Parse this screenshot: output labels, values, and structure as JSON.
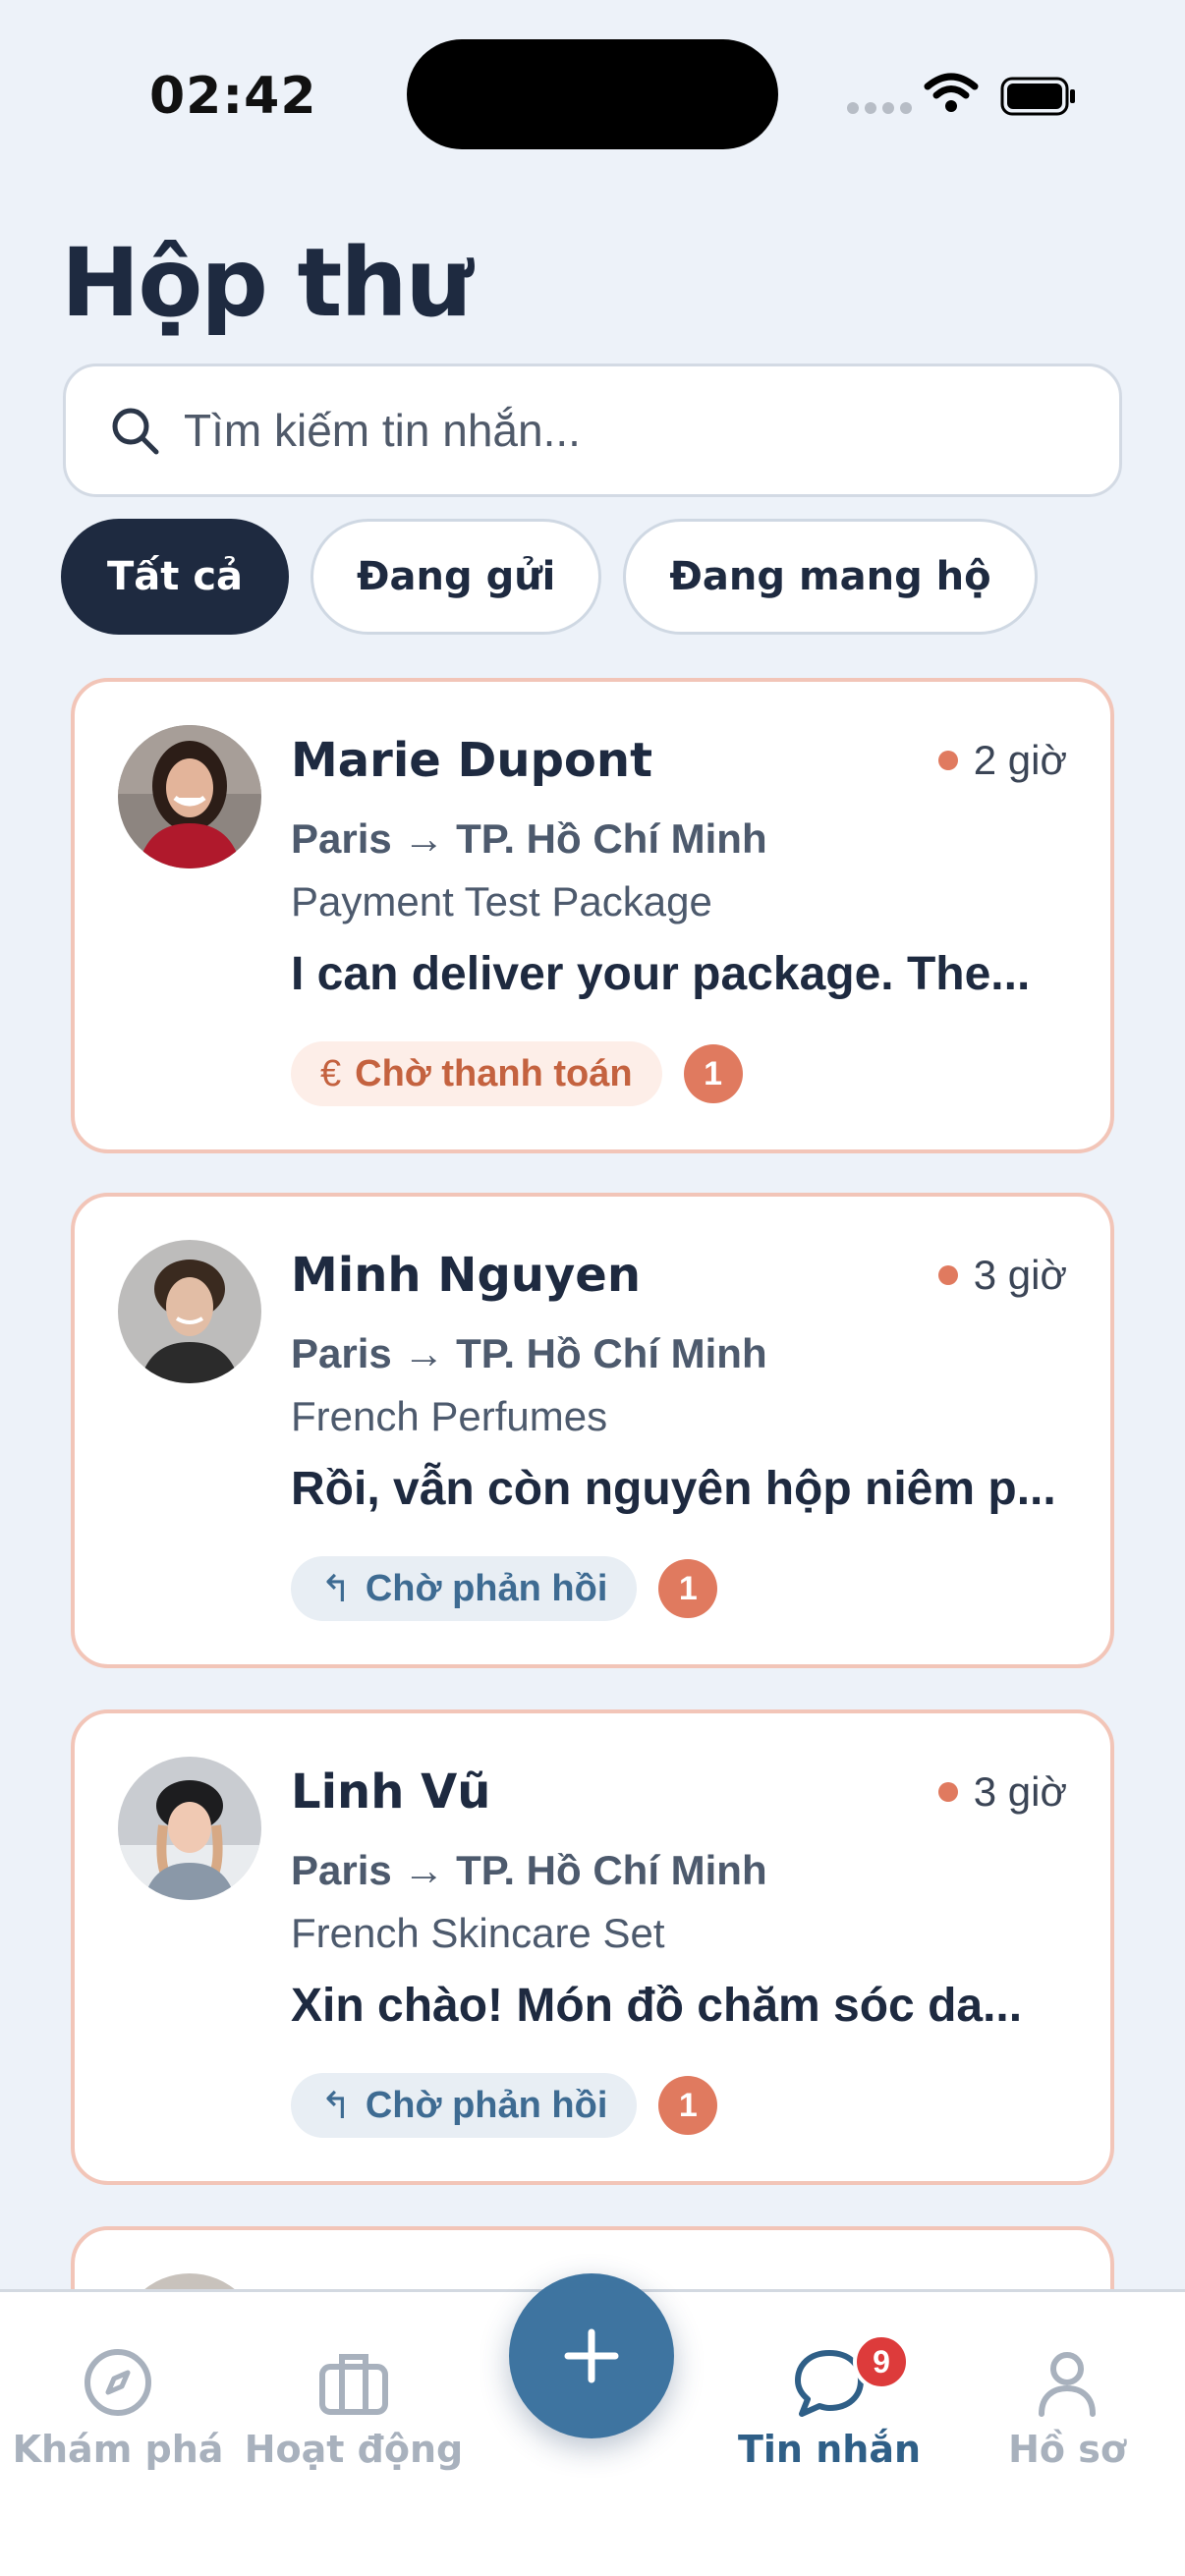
{
  "status_bar": {
    "time": "02:42"
  },
  "page": {
    "title": "Hộp thư"
  },
  "search": {
    "placeholder": "Tìm kiếm tin nhắn..."
  },
  "filters": [
    {
      "label": "Tất cả",
      "active": true
    },
    {
      "label": "Đang gửi",
      "active": false
    },
    {
      "label": "Đang mang hộ",
      "active": false
    }
  ],
  "conversations": [
    {
      "name": "Marie Dupont",
      "time": "2 giờ",
      "route": "Paris → TP. Hồ Chí Minh",
      "package": "Payment Test Package",
      "preview": "I can deliver your package. The...",
      "status": "Chờ thanh toán",
      "status_icon": "euro-icon",
      "unread": "1"
    },
    {
      "name": "Minh Nguyen",
      "time": "3 giờ",
      "route": "Paris → TP. Hồ Chí Minh",
      "package": "French Perfumes",
      "preview": "Rồi, vẫn còn nguyên hộp niêm p...",
      "status": "Chờ phản hồi",
      "status_icon": "reply-icon",
      "unread": "1"
    },
    {
      "name": "Linh Vũ",
      "time": "3 giờ",
      "route": "Paris → TP. Hồ Chí Minh",
      "package": "French Skincare Set",
      "preview": "Xin chào! Món đồ chăm sóc da...",
      "status": "Chờ phản hồi",
      "status_icon": "reply-icon",
      "unread": "1"
    }
  ],
  "bottom_nav": {
    "items": [
      {
        "label": "Khám phá",
        "icon": "compass-icon"
      },
      {
        "label": "Hoạt động",
        "icon": "briefcase-icon"
      },
      {
        "label": "Tin nhắn",
        "icon": "chat-icon",
        "badge": "9",
        "active": true
      },
      {
        "label": "Hồ sơ",
        "icon": "user-icon"
      }
    ],
    "fab_icon": "plus-icon"
  },
  "colors": {
    "background": "#edf2f9",
    "primary_dark": "#1e2a40",
    "accent": "#e07a5f",
    "brand_blue": "#3e74a0",
    "badge_red": "#dd3b3b"
  }
}
